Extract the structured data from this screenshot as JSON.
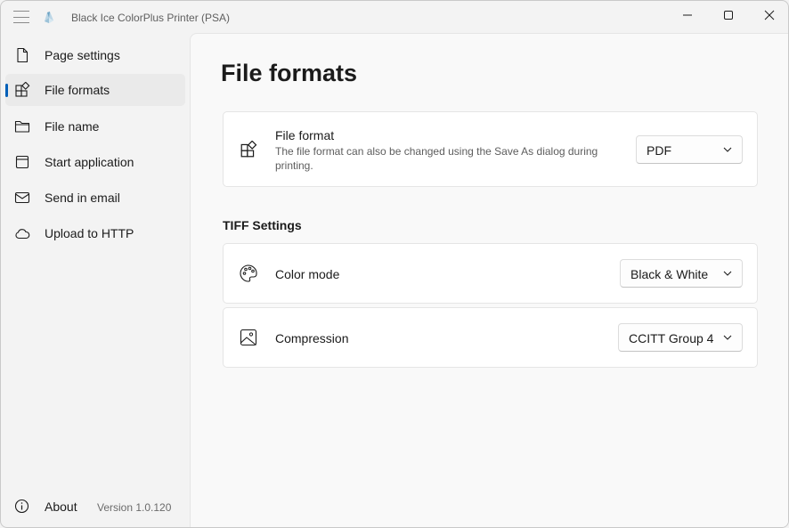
{
  "titlebar": {
    "title": "Black Ice ColorPlus Printer (PSA)",
    "menu_icon": "hamburger-icon",
    "app_icon": "printer-app-icon",
    "controls": [
      "minimize-icon",
      "maximize-icon",
      "close-icon"
    ]
  },
  "sidebar": {
    "items": [
      {
        "label": "Page settings",
        "icon": "page-icon",
        "selected": false
      },
      {
        "label": "File formats",
        "icon": "grid-icon",
        "selected": true
      },
      {
        "label": "File name",
        "icon": "folder-icon",
        "selected": false
      },
      {
        "label": "Start application",
        "icon": "app-window-icon",
        "selected": false
      },
      {
        "label": "Send in email",
        "icon": "mail-icon",
        "selected": false
      },
      {
        "label": "Upload to HTTP",
        "icon": "cloud-icon",
        "selected": false
      }
    ],
    "about": {
      "label": "About",
      "icon": "info-icon",
      "version": "Version 1.0.120"
    }
  },
  "main": {
    "title": "File formats",
    "file_format": {
      "title": "File format",
      "description": "The file format can also be changed using the Save As dialog during printing.",
      "value": "PDF",
      "icon": "grid-icon"
    },
    "tiff_section": "TIFF Settings",
    "color_mode": {
      "title": "Color mode",
      "value": "Black & White",
      "icon": "palette-icon"
    },
    "compression": {
      "title": "Compression",
      "value": "CCITT Group 4",
      "icon": "image-icon"
    }
  },
  "colors": {
    "accent": "#005fb8",
    "background": "#f3f3f3",
    "content_bg": "#f9f9f9",
    "card_bg": "#ffffff"
  }
}
